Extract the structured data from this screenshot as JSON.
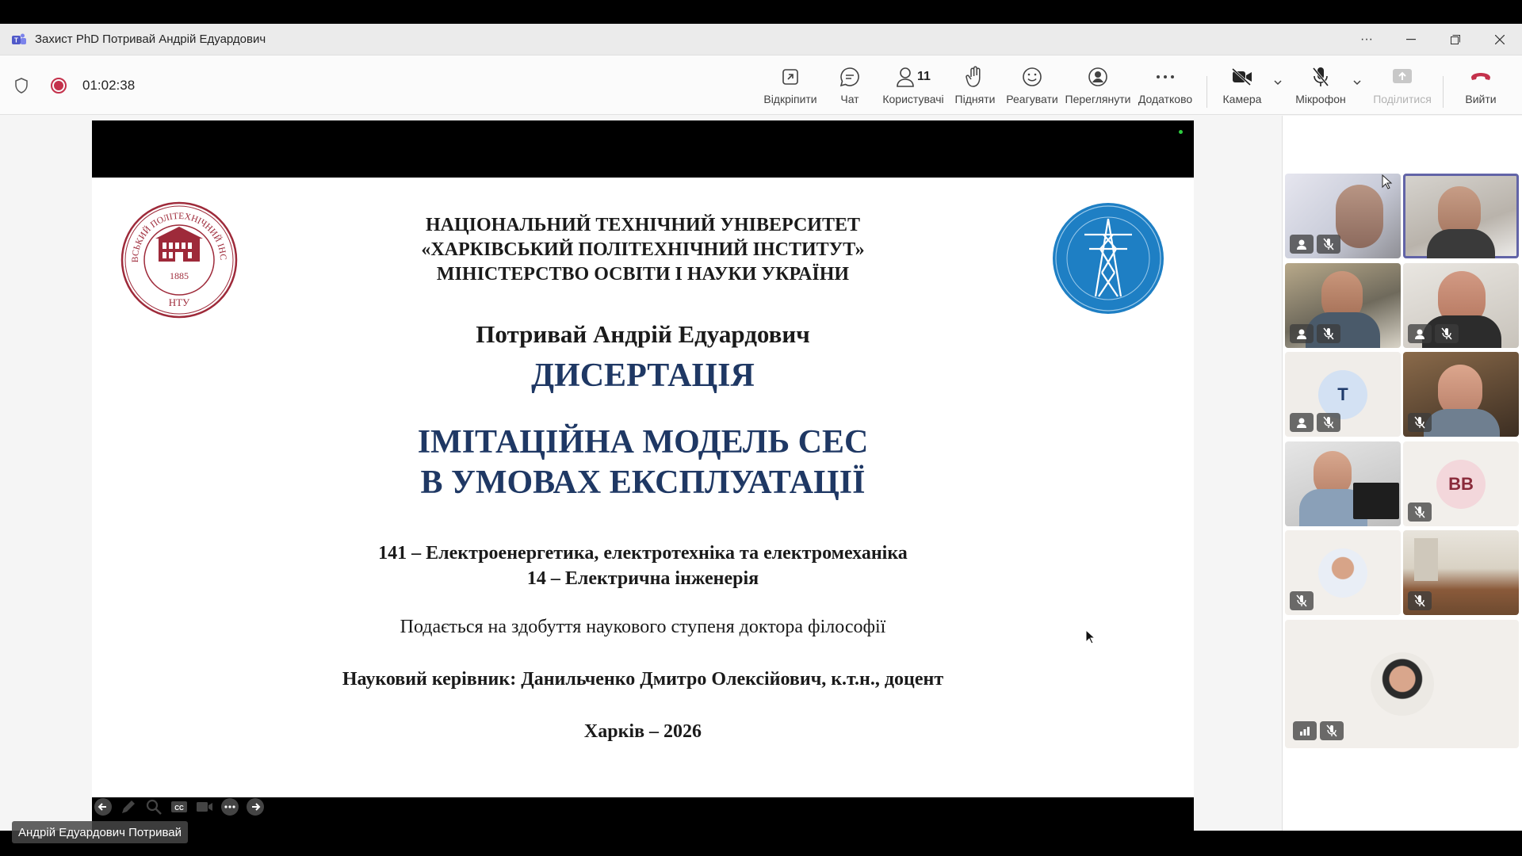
{
  "window": {
    "title": "Захист PhD Потривай Андрій Едуардович"
  },
  "meeting": {
    "elapsed": "01:02:38"
  },
  "toolbar": {
    "popout": "Відкріпити",
    "chat": "Чат",
    "people": "Користувачі",
    "people_count": "11",
    "raise": "Підняти",
    "react": "Реагувати",
    "view": "Переглянути",
    "more": "Додатково",
    "camera": "Камера",
    "mic": "Мікрофон",
    "share": "Поділитися",
    "leave": "Вийти"
  },
  "slide": {
    "university_line1": "НАЦІОНАЛЬНИЙ ТЕХНІЧНИЙ УНІВЕРСИТЕТ",
    "university_line2": "«ХАРКІВСЬКИЙ ПОЛІТЕХНІЧНИЙ ІНСТИТУТ»",
    "university_line3": "МІНІСТЕРСТВО ОСВІТИ І НАУКИ УКРАЇНИ",
    "author": "Потривай Андрій Едуардович",
    "doc_type": "ДИСЕРТАЦІЯ",
    "title_line1": "ІМІТАЦІЙНА МОДЕЛЬ СЕС",
    "title_line2": "В УМОВАХ ЕКСПЛУАТАЦІЇ",
    "specialty1": "141 – Електроенергетика, електротехніка та електромеханіка",
    "specialty2": "14 – Електрична інженерія",
    "degree": "Подається на здобуття наукового ступеня доктора філософії",
    "supervisor": "Науковий керівник: Данильченко Дмитро Олексійович, к.т.н., доцент",
    "city_year": "Харків – 2026",
    "logo_left_year": "1885",
    "logo_left_arc": "ХАРКІВСЬКИЙ ПОЛІТЕХНІЧНИЙ ІНСТИТУТ",
    "logo_left_bottom": "НТУ"
  },
  "presenter": {
    "name": "Андрій Едуардович Потривай"
  },
  "participants": {
    "initials_t": "T",
    "initials_vv": "BB"
  },
  "colors": {
    "accent": "#6264a7",
    "recording": "#c4314b",
    "leave": "#c4314b",
    "slide_title": "#1f3864",
    "logo_left": "#9e2a3a",
    "logo_right": "#1e7fc4"
  }
}
